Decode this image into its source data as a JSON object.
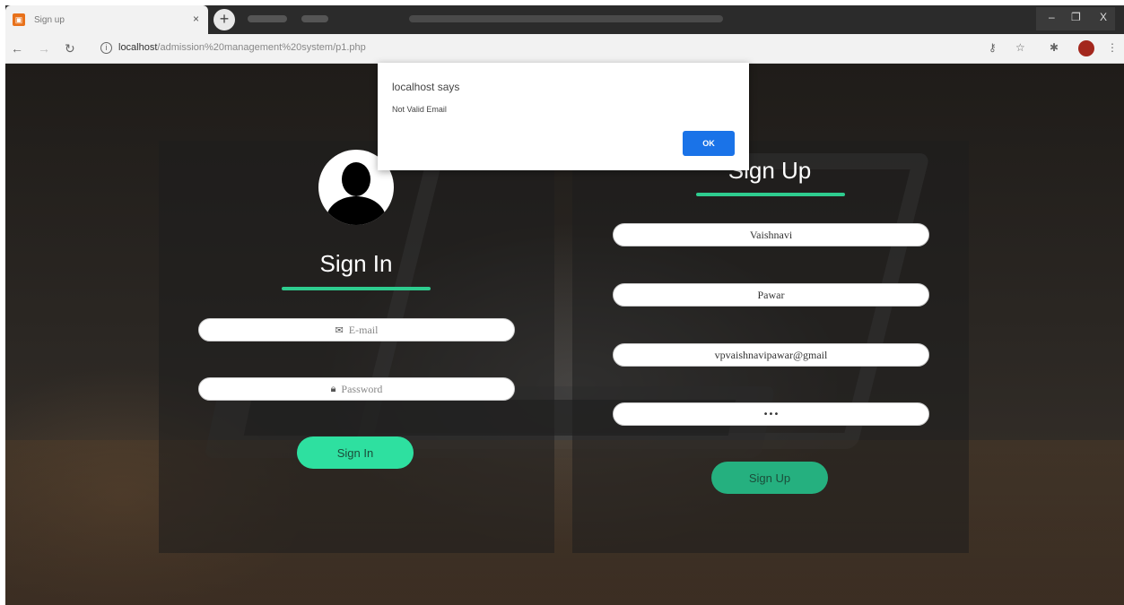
{
  "browser": {
    "tab_title": "Sign up",
    "tab_close": "×",
    "new_tab": "+",
    "url_host": "localhost",
    "url_path": "/admission%20management%20system/p1.php",
    "window_minimize": "–",
    "window_maximize": "❐",
    "window_close": "X"
  },
  "signin": {
    "heading": "Sign In",
    "email_placeholder": "E-mail",
    "password_placeholder": "Password",
    "button": "Sign In"
  },
  "signup": {
    "heading": "Sign Up",
    "first_name": "Vaishnavi",
    "last_name": "Pawar",
    "email": "vpvaishnavipawar@gmail",
    "password": "•••",
    "button": "Sign Up"
  },
  "dialog": {
    "title": "localhost says",
    "message": "Not Valid Email",
    "ok": "OK"
  },
  "colors": {
    "accent": "#2ecc8f",
    "signin_button": "#2ee0a0",
    "signup_button": "#25b07f",
    "dialog_button": "#1a73e8"
  }
}
